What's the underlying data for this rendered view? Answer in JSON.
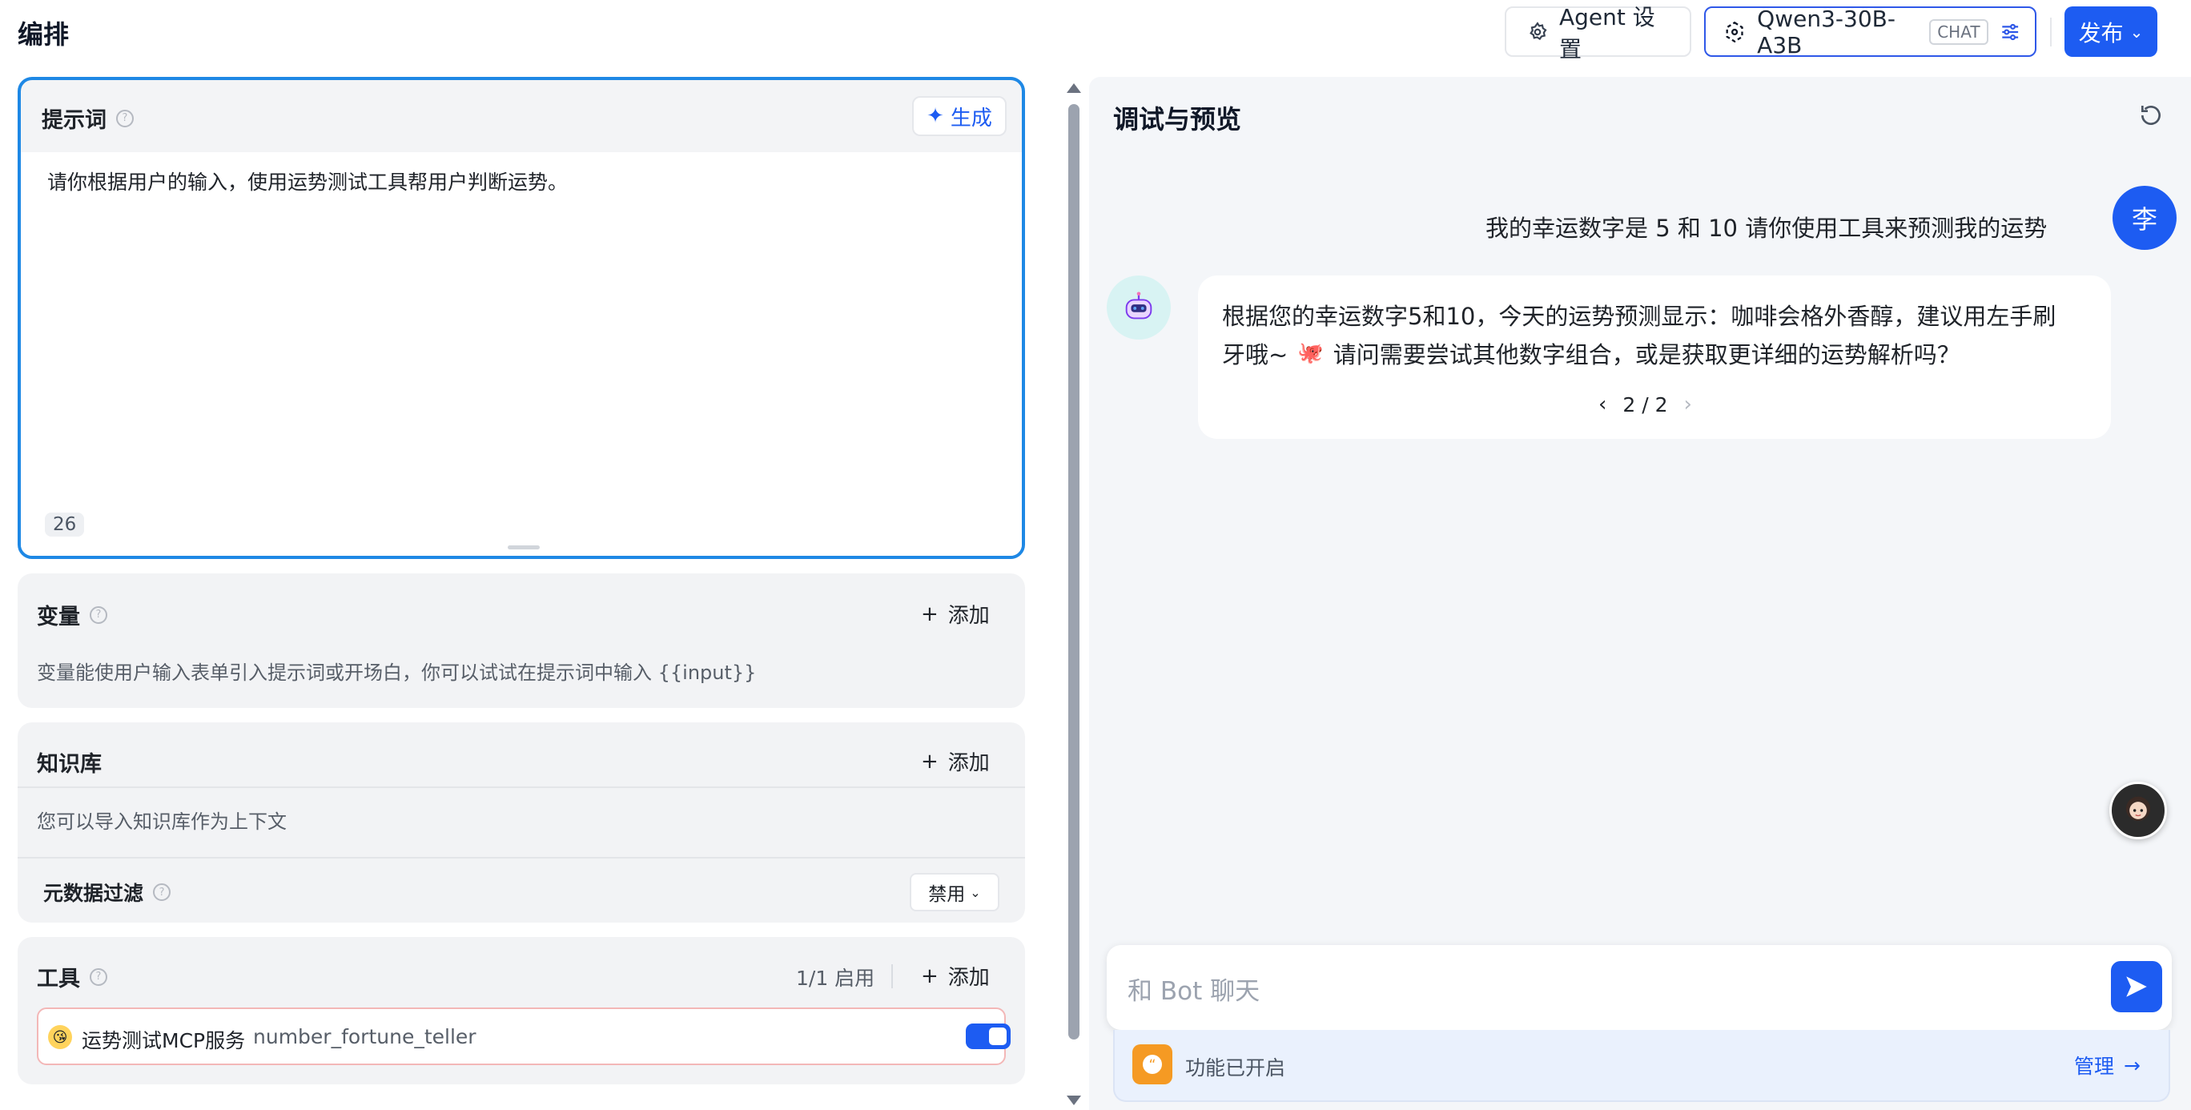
{
  "header": {
    "title": "编排",
    "agent_settings": "Agent 设置",
    "model_name": "Qwen3-30B-A3B",
    "model_badge": "CHAT",
    "publish": "发布"
  },
  "prompt": {
    "title": "提示词",
    "generate": "生成",
    "text": "请你根据用户的输入，使用运势测试工具帮用户判断运势。",
    "char_count": "26"
  },
  "variables": {
    "title": "变量",
    "add": "添加",
    "description": "变量能使用户输入表单引入提示词或开场白，你可以试试在提示词中输入 {{input}}"
  },
  "knowledge": {
    "title": "知识库",
    "add": "添加",
    "description": "您可以导入知识库作为上下文",
    "metadata_filter": "元数据过滤",
    "filter_value": "禁用"
  },
  "tools": {
    "title": "工具",
    "enabled_count": "1/1 启用",
    "add": "添加",
    "items": [
      {
        "name": "运势测试MCP服务",
        "id": "number_fortune_teller",
        "enabled": true
      }
    ]
  },
  "debug": {
    "title": "调试与预览",
    "user_avatar": "李",
    "user_message": "我的幸运数字是 5 和 10 请你使用工具来预测我的运势",
    "bot_message_line1": "根据您的幸运数字5和10，今天的运势预测显示：咖啡会格外香醇，建议用左手刷",
    "bot_message_line2_a": "牙哦~",
    "bot_message_line2_b": "请问需要尝试其他数字组合，或是获取更详细的运势解析吗？",
    "pager": "2 / 2",
    "input_placeholder": "和 Bot 聊天",
    "feature_status": "功能已开启",
    "manage": "管理"
  },
  "colors": {
    "accent": "#1d5cf2",
    "prompt_border": "#1e88e5",
    "feature_icon": "#f59a23"
  }
}
